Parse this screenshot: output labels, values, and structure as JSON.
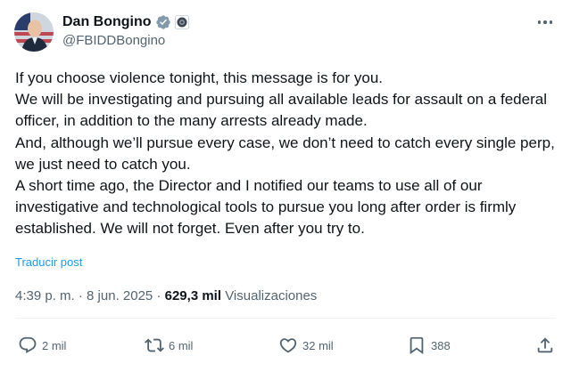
{
  "author": {
    "display_name": "Dan Bongino",
    "handle": "@FBIDDBongino",
    "avatar_icon": "profile-photo",
    "verified_icon": "verified-badge-icon",
    "affiliation_icon": "government-seal-icon"
  },
  "tweet": {
    "paragraphs": [
      "If you choose violence tonight, this message is for you.",
      "We will be investigating and pursuing all available leads for assault on a federal officer, in addition to the many arrests already made.",
      "And, although we’ll pursue every case, we don’t need to catch every single perp, we just need to catch you.",
      "A short time ago, the Director and I notified our teams to use all of our investigative and technological tools to pursue you long after order is firmly established. We will not forget. Even after you try to."
    ],
    "translate_label": "Traducir post"
  },
  "meta": {
    "time": "4:39 p. m.",
    "separator": "·",
    "date": "8 jun. 2025",
    "views_count": "629,3 mil",
    "views_label": "Visualizaciones"
  },
  "actions": {
    "replies": "2 mil",
    "reposts": "6 mil",
    "likes": "32 mil",
    "bookmarks": "388"
  },
  "colors": {
    "text": "#0f1419",
    "secondary": "#536471",
    "link": "#1d9bf0",
    "divider": "#eff3f4"
  }
}
